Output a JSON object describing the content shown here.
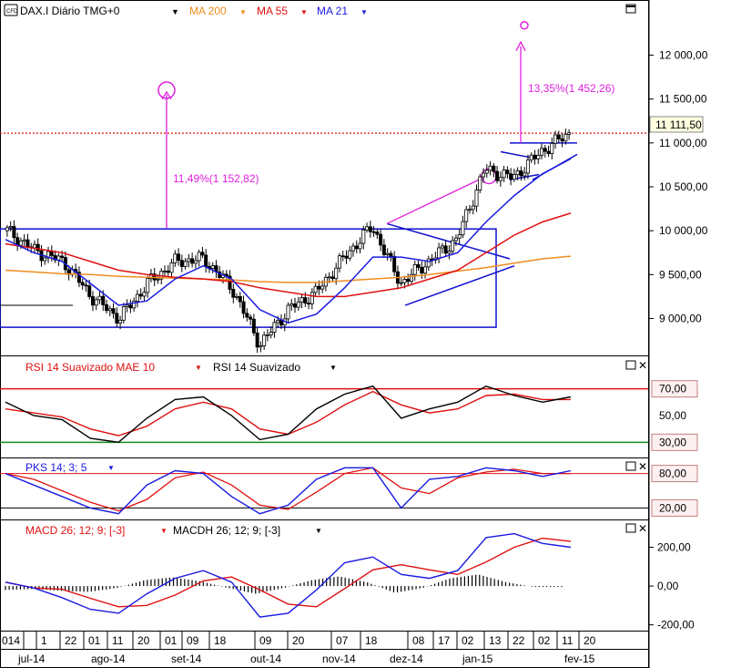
{
  "header": {
    "symbol": "DAX.I Diário TMG+0",
    "indicators": [
      {
        "label": "MA 200",
        "color": "#f08c1e"
      },
      {
        "label": "MA 55",
        "color": "#e01010"
      },
      {
        "label": "MA 21",
        "color": "#1a1ae0"
      }
    ]
  },
  "colors": {
    "ma200": "#f08c1e",
    "ma55": "#e01010",
    "ma21": "#1a1ae0",
    "annotation": "#e020e0",
    "pattern": "#1010d0",
    "candle_up": "#ffffff",
    "candle_down": "#000000"
  },
  "price_panel": {
    "last_price": "11 111,50",
    "annotation_left": "11,49%(1 152,82)",
    "annotation_right": "13,35%(1 452,26)",
    "ylim": [
      8600,
      12400
    ],
    "ticks": [
      {
        "v": 9000,
        "label": "9 000,00"
      },
      {
        "v": 9500,
        "label": "9 500,00"
      },
      {
        "v": 10000,
        "label": "10 000,00"
      },
      {
        "v": 10500,
        "label": "10 500,00"
      },
      {
        "v": 11000,
        "label": "11 000,00"
      },
      {
        "v": 11500,
        "label": "11 500,00"
      },
      {
        "v": 12000,
        "label": "12 000,00"
      }
    ]
  },
  "rsi_panel": {
    "title_1": "RSI 14 Suavizado MAE 10",
    "title_2": "RSI 14 Suavizado",
    "ylim": [
      20,
      80
    ],
    "ticks": [
      {
        "v": 70,
        "label": "70,00",
        "boxed": true
      },
      {
        "v": 50,
        "label": "50,00",
        "boxed": false
      },
      {
        "v": 30,
        "label": "30,00",
        "boxed": true
      }
    ]
  },
  "pks_panel": {
    "title": "PKS 14; 3; 5",
    "ylim": [
      0,
      100
    ],
    "ticks": [
      {
        "v": 80,
        "label": "80,00",
        "boxed": true
      },
      {
        "v": 20,
        "label": "20,00",
        "boxed": true
      }
    ]
  },
  "macd_panel": {
    "title_1": "MACD 26; 12; 9; [-3]",
    "title_2": "MACDH 26; 12; 9; [-3]",
    "ylim": [
      -230,
      320
    ],
    "ticks": [
      {
        "v": 200,
        "label": "200,00"
      },
      {
        "v": 0,
        "label": "0,00"
      },
      {
        "v": -200,
        "label": "-200,00"
      }
    ]
  },
  "x_axis": {
    "days": [
      "014",
      "1",
      "22",
      "01",
      "11",
      "20",
      "01",
      "09",
      "18",
      "09",
      "20",
      "07",
      "18",
      "08",
      "17",
      "02",
      "13",
      "22",
      "02",
      "11",
      "20"
    ],
    "months": [
      "jul-14",
      "ago-14",
      "set-14",
      "out-14",
      "nov-14",
      "dez-14",
      "jan-15",
      "fev-15"
    ]
  },
  "chart_data": {
    "type": "line",
    "title": "DAX.I Diário TMG+0",
    "x": [
      "2014-06-20",
      "2014-07-01",
      "2014-07-15",
      "2014-07-30",
      "2014-08-10",
      "2014-08-25",
      "2014-09-05",
      "2014-09-18",
      "2014-10-01",
      "2014-10-15",
      "2014-10-28",
      "2014-11-10",
      "2014-11-25",
      "2014-12-05",
      "2014-12-16",
      "2014-12-30",
      "2015-01-12",
      "2015-01-22",
      "2015-02-02",
      "2015-02-12",
      "2015-02-17"
    ],
    "series": [
      {
        "name": "DAX.I",
        "values": [
          10000,
          9770,
          9650,
          9250,
          9000,
          9400,
          9650,
          9680,
          9350,
          8700,
          9100,
          9300,
          9700,
          10050,
          9400,
          9650,
          9900,
          10700,
          10600,
          10900,
          11111.5
        ]
      },
      {
        "name": "MA 200",
        "values": [
          9550,
          9530,
          9510,
          9500,
          9480,
          9470,
          9460,
          9450,
          9440,
          9420,
          9410,
          9410,
          9430,
          9450,
          9470,
          9500,
          9540,
          9580,
          9630,
          9680,
          9710
        ]
      },
      {
        "name": "MA 55",
        "values": [
          9850,
          9800,
          9750,
          9650,
          9550,
          9500,
          9470,
          9450,
          9420,
          9350,
          9300,
          9250,
          9250,
          9300,
          9350,
          9450,
          9550,
          9750,
          9950,
          10100,
          10200
        ]
      },
      {
        "name": "MA 21",
        "values": [
          9900,
          9750,
          9650,
          9400,
          9150,
          9200,
          9450,
          9600,
          9450,
          9100,
          8950,
          9050,
          9350,
          9700,
          9700,
          9650,
          9750,
          10100,
          10400,
          10650,
          10820
        ]
      }
    ],
    "panels": {
      "rsi": {
        "x_ref": "same as x",
        "series": [
          {
            "name": "RSI 14 Suavizado",
            "values": [
              60,
              50,
              47,
              33,
              30,
              48,
              62,
              64,
              50,
              32,
              36,
              55,
              66,
              72,
              48,
              55,
              60,
              72,
              65,
              60,
              64
            ]
          },
          {
            "name": "RSI 14 Suavizado MAE 10",
            "values": [
              55,
              52,
              49,
              40,
              35,
              42,
              55,
              60,
              55,
              40,
              36,
              45,
              58,
              68,
              58,
              52,
              55,
              65,
              66,
              62,
              62
            ]
          }
        ]
      },
      "pks": {
        "series": [
          {
            "name": "PKS 14; 3; 5",
            "values": [
              80,
              60,
              40,
              20,
              10,
              60,
              85,
              80,
              40,
              10,
              25,
              70,
              90,
              90,
              20,
              70,
              75,
              90,
              85,
              75,
              85
            ]
          }
        ]
      },
      "macd": {
        "series": [
          {
            "name": "MACD 26; 12; 9; [-3]",
            "values": [
              20,
              -10,
              -60,
              -120,
              -140,
              -40,
              40,
              80,
              20,
              -160,
              -140,
              -20,
              120,
              150,
              60,
              40,
              80,
              250,
              270,
              220,
              200
            ]
          },
          {
            "name": "MACDH 26; 12; 9; [-3]",
            "values": [
              -20,
              -15,
              -25,
              -30,
              -10,
              30,
              45,
              25,
              -10,
              -40,
              -10,
              30,
              50,
              20,
              -35,
              -10,
              40,
              60,
              20,
              -5,
              -5
            ]
          }
        ]
      }
    }
  }
}
